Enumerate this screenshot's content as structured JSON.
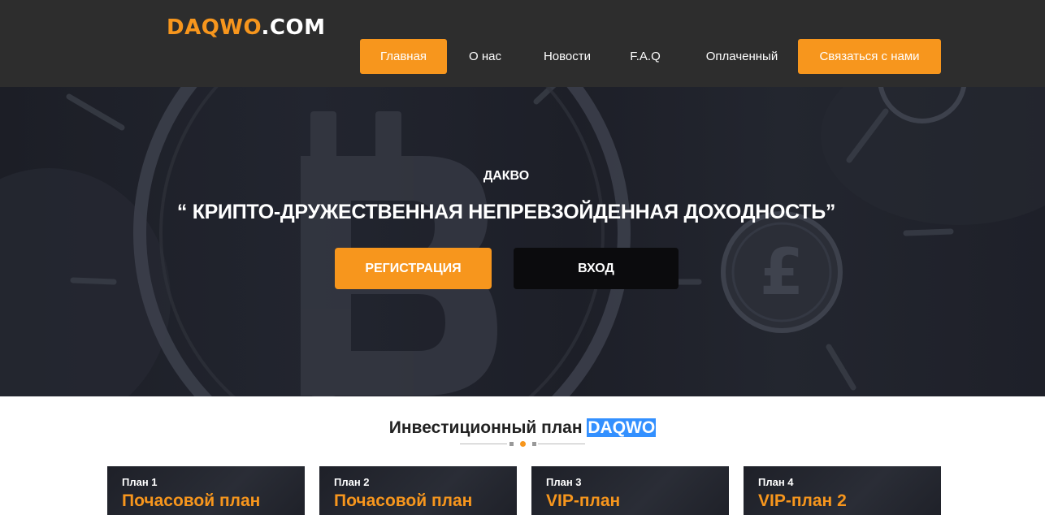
{
  "logo": {
    "brand": "DAQWO",
    "tld": ".COM"
  },
  "nav": {
    "items": [
      {
        "label": "Главная",
        "active": true
      },
      {
        "label": "О нас"
      },
      {
        "label": "Новости"
      },
      {
        "label": "F.A.Q"
      },
      {
        "label": "Оплаченный"
      },
      {
        "label": "Связаться с нами",
        "cta": true
      }
    ]
  },
  "hero": {
    "subtitle": "ДАКВО",
    "title": "“ КРИПТО-ДРУЖЕСТВЕННАЯ НЕПРЕВЗОЙДЕННАЯ ДОХОДНОСТЬ”",
    "register_label": "РЕГИСТРАЦИЯ",
    "login_label": "ВХОД",
    "bg_icons": [
      "bitcoin-coin-icon",
      "pound-coin-icon"
    ]
  },
  "plans_section": {
    "title_prefix": "Инвестиционный план ",
    "title_highlight": "DAQWO",
    "plans": [
      {
        "number": "План 1",
        "name": "Почасовой план"
      },
      {
        "number": "План 2",
        "name": "Почасовой план"
      },
      {
        "number": "План 3",
        "name": "VIP-план"
      },
      {
        "number": "План 4",
        "name": "VIP-план 2"
      }
    ]
  },
  "colors": {
    "accent": "#f7961d",
    "header_bg": "#2d2d2d",
    "hero_bg": "#1f222b",
    "login_button": "#0b0b0d",
    "selection_highlight": "#3390ff"
  }
}
